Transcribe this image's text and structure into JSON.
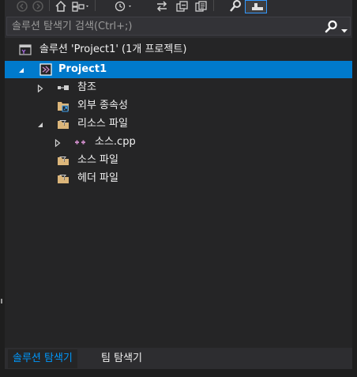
{
  "search": {
    "placeholder": "솔루션 탐색기 검색(Ctrl+;)"
  },
  "toolbar": {
    "buttons": [
      "back-icon",
      "forward-icon",
      "home-icon",
      "switch-views-icon",
      "history-icon",
      "sync-icon",
      "collapse-all-icon",
      "show-all-files-icon",
      "properties-icon",
      "preview-icon"
    ]
  },
  "tree": {
    "solution_label": "솔루션 'Project1' (1개 프로젝트)",
    "project_label": "Project1",
    "references_label": "참조",
    "external_deps_label": "외부 종속성",
    "resource_files_label": "리소스 파일",
    "cpp_file_label": "소스.cpp",
    "source_files_label": "소스 파일",
    "header_files_label": "헤더 파일"
  },
  "tabs": {
    "solution_explorer": "솔루션 탐색기",
    "team_explorer": "팀 탐색기"
  },
  "colors": {
    "background": "#252526",
    "selection": "#007acc",
    "active_tab_text": "#0097fb",
    "folder": "#dcb67a"
  }
}
